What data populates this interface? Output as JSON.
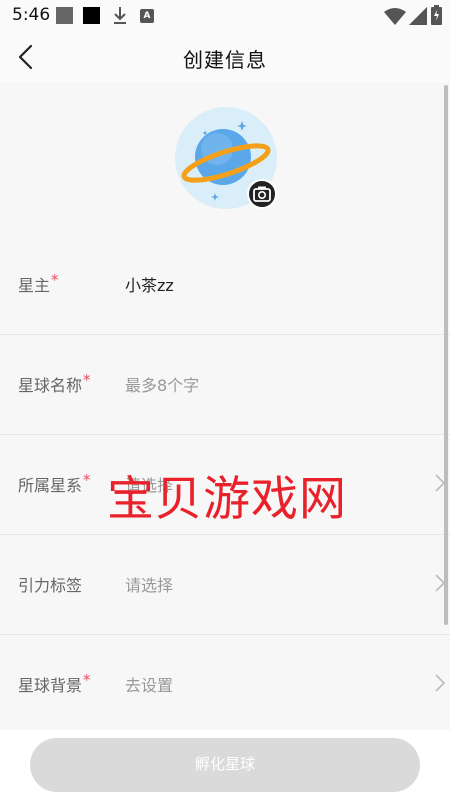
{
  "status_bar": {
    "time": "5:46",
    "icons": [
      "gallery-icon",
      "app-icon",
      "download-icon",
      "a-icon",
      "wifi-icon",
      "signal-icon",
      "battery-icon"
    ],
    "a_letter": "A"
  },
  "header": {
    "title": "创建信息",
    "back_icon": "chevron-left-icon"
  },
  "avatar": {
    "icon": "planet-icon",
    "badge_icon": "camera-icon",
    "bg_color": "#d9eef9",
    "ring_color": "#f4a019",
    "planet_color": "#5aa8ea"
  },
  "form": {
    "rows": [
      {
        "label": "星主",
        "required": "*",
        "value": "小茶zz",
        "filled": true,
        "chevron": false
      },
      {
        "label": "星球名称",
        "required": "*",
        "value": "最多8个字",
        "filled": false,
        "chevron": false
      },
      {
        "label": "所属星系",
        "required": "*",
        "value": "请选择",
        "filled": false,
        "chevron": true
      },
      {
        "label": "引力标签",
        "required": "",
        "value": "请选择",
        "filled": false,
        "chevron": true
      },
      {
        "label": "星球背景",
        "required": "*",
        "value": "去设置",
        "filled": false,
        "chevron": true
      }
    ]
  },
  "watermark": "宝贝游戏网",
  "submit": {
    "label": "孵化星球",
    "bg_color": "#dadada"
  },
  "colors": {
    "required_star": "#e84b5a",
    "watermark": "#e8212b"
  }
}
